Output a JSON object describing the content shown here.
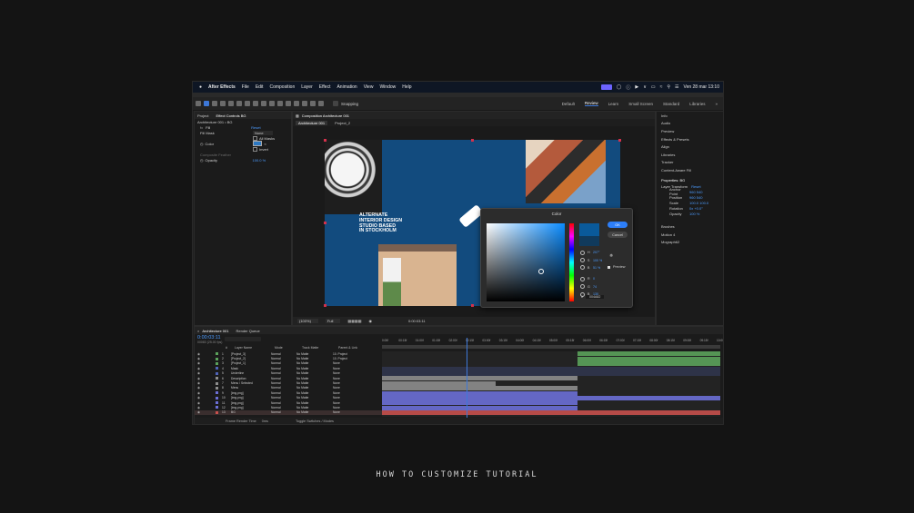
{
  "menubar": {
    "app": "After Effects",
    "items": [
      "File",
      "Edit",
      "Composition",
      "Layer",
      "Effect",
      "Animation",
      "View",
      "Window",
      "Help"
    ],
    "clock": "Ven 28 mar 13:10"
  },
  "workspaces": [
    "Default",
    "Review",
    "Learn",
    "Small Screen",
    "Standard",
    "Libraries"
  ],
  "snapping": "Snapping",
  "left_panel": {
    "tabs": [
      "Project",
      "Effect Controls BG"
    ],
    "layer": "Architecture 001 • BG",
    "rows": [
      "Fill",
      "Fill Mask",
      "Color",
      "Composite Feather",
      "Opacity"
    ],
    "opacity": "100.0 %",
    "reset": "Reset",
    "fill_mask_value": "None",
    "all_masks": "All Masks",
    "invert": "Invert"
  },
  "composition": {
    "tab": "Composition Architecture 001",
    "subtabs": [
      "Architecture 001",
      "Project_2"
    ],
    "headline": [
      "ALTERNATE",
      "INTERIOR DESIGN",
      "STUDIO BASED",
      "IN STOCKHOLM"
    ],
    "zoom": "(100%)",
    "resolution": "Full",
    "timecode": "0:00:03:11"
  },
  "right_panel": {
    "items": [
      "Info",
      "Audio",
      "Preview",
      "Effects & Presets",
      "Align",
      "Libraries",
      "Tracker",
      "Content-Aware Fill"
    ],
    "properties_title": "Properties: BG",
    "layer_transform": "Layer Transform",
    "reset": "Reset",
    "transform": [
      {
        "name": "Anchor Point",
        "value": "960  540"
      },
      {
        "name": "Position",
        "value": "960  540"
      },
      {
        "name": "Scale",
        "value": "100.0  100.0"
      },
      {
        "name": "Rotation",
        "value": "0x +0.0°"
      },
      {
        "name": "Opacity",
        "value": "100 %"
      }
    ],
    "lower": [
      "Brushes",
      "Motion 4",
      "Mograph62"
    ]
  },
  "color_dialog": {
    "title": "Color",
    "ok": "OK",
    "cancel": "Cancel",
    "preview": "Preview",
    "hex": "004A82",
    "fields": [
      {
        "label": "H",
        "value": "207°"
      },
      {
        "label": "S",
        "value": "100 %"
      },
      {
        "label": "B",
        "value": "51 %"
      },
      {
        "label": "R",
        "value": "0"
      },
      {
        "label": "G",
        "value": "74"
      },
      {
        "label": "B",
        "value": "130"
      }
    ]
  },
  "timeline": {
    "tabs": [
      "Architecture 001",
      "Render Queue"
    ],
    "timecode": "0:00:03:11",
    "fps": "00083 (25.00 fps)",
    "columns": [
      "#",
      "Layer Name",
      "Mode",
      "Track Matte",
      "Parent & Link"
    ],
    "layers": [
      {
        "num": "1",
        "name": "[Project_3]",
        "mode": "Normal",
        "matte": "No Matte",
        "parent": "10. Project"
      },
      {
        "num": "2",
        "name": "[Project_2]",
        "mode": "Normal",
        "matte": "No Matte",
        "parent": "10. Project"
      },
      {
        "num": "3",
        "name": "[Project_1]",
        "mode": "Normal",
        "matte": "No Matte",
        "parent": "None"
      },
      {
        "num": "4",
        "name": "Mask",
        "mode": "Normal",
        "matte": "No Matte",
        "parent": "None"
      },
      {
        "num": "5",
        "name": "Underline",
        "mode": "Normal",
        "matte": "No Matte",
        "parent": "None"
      },
      {
        "num": "6",
        "name": "Description",
        "mode": "Normal",
        "matte": "No Matte",
        "parent": "None"
      },
      {
        "num": "7",
        "name": "Menu / Selected",
        "mode": "Normal",
        "matte": "No Matte",
        "parent": "None"
      },
      {
        "num": "8",
        "name": "Menu",
        "mode": "Normal",
        "matte": "No Matte",
        "parent": "None"
      },
      {
        "num": "9",
        "name": "[img.png]",
        "mode": "Normal",
        "matte": "No Matte",
        "parent": "None"
      },
      {
        "num": "10",
        "name": "[img.png]",
        "mode": "Normal",
        "matte": "No Matte",
        "parent": "None"
      },
      {
        "num": "11",
        "name": "[img.png]",
        "mode": "Normal",
        "matte": "No Matte",
        "parent": "None"
      },
      {
        "num": "12",
        "name": "[img.png]",
        "mode": "Normal",
        "matte": "No Matte",
        "parent": "None"
      },
      {
        "num": "13",
        "name": "BG",
        "mode": "Normal",
        "matte": "No Matte",
        "parent": "None"
      }
    ],
    "ruler": [
      "0:00f",
      "00:15f",
      "01:00f",
      "01:15f",
      "02:00f",
      "02:15f",
      "03:00f",
      "03:15f",
      "04:00f",
      "04:15f",
      "05:00f",
      "05:15f",
      "06:00f",
      "06:15f",
      "07:00f",
      "07:15f",
      "08:00f",
      "08:15f",
      "09:00f",
      "09:15f",
      "10:00f"
    ],
    "footer_left": "Frame Render Time",
    "footer_time": "0ms",
    "footer_mid": "Toggle Switches / Modes"
  },
  "caption": "HOW TO CUSTOMIZE TUTORIAL"
}
